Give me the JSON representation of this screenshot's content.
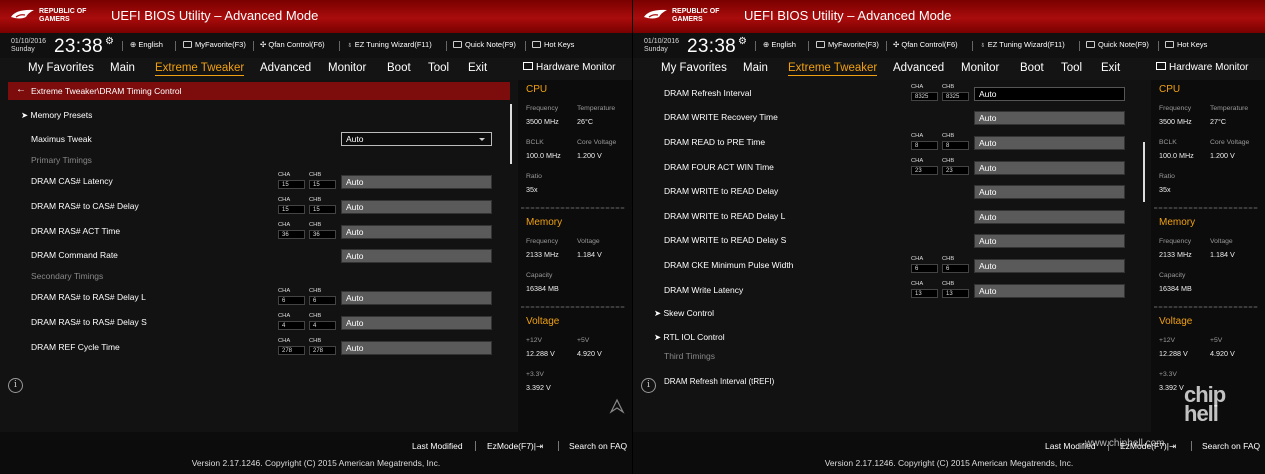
{
  "header": {
    "brand": "REPUBLIC OF\nGAMERS",
    "title": "UEFI BIOS Utility – Advanced Mode"
  },
  "infobar": {
    "date": "01/10/2016",
    "day": "Sunday",
    "time": "23:38",
    "tools": [
      "English",
      "MyFavorite(F3)",
      "Qfan Control(F6)",
      "EZ Tuning Wizard(F11)",
      "Quick Note(F9)",
      "Hot Keys"
    ]
  },
  "menu": {
    "items": [
      "My Favorites",
      "Main",
      "Extreme Tweaker",
      "Advanced",
      "Monitor",
      "Boot",
      "Tool",
      "Exit"
    ],
    "active": "Extreme Tweaker",
    "hardware_monitor": "Hardware Monitor"
  },
  "left_panel": {
    "breadcrumb": "Extreme Tweaker\\DRAM Timing Control",
    "memory_presets": "Memory Presets",
    "maximus_tweak": {
      "label": "Maximus Tweak",
      "value": "Auto"
    },
    "primary_timings": "Primary Timings",
    "secondary_timings": "Secondary Timings",
    "rows": [
      {
        "label": "DRAM CAS# Latency",
        "cha": "15",
        "chb": "15",
        "value": "Auto"
      },
      {
        "label": "DRAM RAS# to CAS# Delay",
        "cha": "15",
        "chb": "15",
        "value": "Auto"
      },
      {
        "label": "DRAM RAS# ACT Time",
        "cha": "36",
        "chb": "36",
        "value": "Auto"
      },
      {
        "label": "DRAM Command Rate",
        "cha": "",
        "chb": "",
        "value": "Auto"
      },
      {
        "label": "DRAM RAS# to RAS# Delay L",
        "cha": "6",
        "chb": "6",
        "value": "Auto"
      },
      {
        "label": "DRAM RAS# to RAS# Delay S",
        "cha": "4",
        "chb": "4",
        "value": "Auto"
      },
      {
        "label": "DRAM REF Cycle Time",
        "cha": "278",
        "chb": "278",
        "value": "Auto"
      }
    ]
  },
  "right_panel": {
    "rows": [
      {
        "label": "DRAM Refresh Interval",
        "cha": "8325",
        "chb": "8325",
        "value": "Auto"
      },
      {
        "label": "DRAM WRITE Recovery Time",
        "cha": "",
        "chb": "",
        "value": "Auto"
      },
      {
        "label": "DRAM READ to PRE Time",
        "cha": "8",
        "chb": "8",
        "value": "Auto"
      },
      {
        "label": "DRAM FOUR ACT WIN Time",
        "cha": "23",
        "chb": "23",
        "value": "Auto"
      },
      {
        "label": "DRAM WRITE to READ Delay",
        "cha": "",
        "chb": "",
        "value": "Auto"
      },
      {
        "label": "DRAM WRITE to READ Delay L",
        "cha": "",
        "chb": "",
        "value": "Auto"
      },
      {
        "label": "DRAM WRITE to READ Delay S",
        "cha": "",
        "chb": "",
        "value": "Auto"
      },
      {
        "label": "DRAM CKE Minimum Pulse Width",
        "cha": "6",
        "chb": "6",
        "value": "Auto"
      },
      {
        "label": "DRAM Write Latency",
        "cha": "13",
        "chb": "13",
        "value": "Auto"
      }
    ],
    "skew_control": "Skew Control",
    "rtl_iol_control": "RTL IOL Control",
    "third_timings": "Third Timings",
    "refresh_interval_trefi": "DRAM Refresh Interval (tREFI)"
  },
  "channel_labels": {
    "cha": "CHA",
    "chb": "CHB"
  },
  "hw_left": {
    "cpu": {
      "title": "CPU",
      "frequency_label": "Frequency",
      "frequency": "3500 MHz",
      "temperature_label": "Temperature",
      "temperature": "26°C",
      "bclk_label": "BCLK",
      "bclk": "100.0 MHz",
      "core_voltage_label": "Core Voltage",
      "core_voltage": "1.200 V",
      "ratio_label": "Ratio",
      "ratio": "35x"
    },
    "memory": {
      "title": "Memory",
      "frequency_label": "Frequency",
      "frequency": "2133 MHz",
      "voltage_label": "Voltage",
      "voltage": "1.184 V",
      "capacity_label": "Capacity",
      "capacity": "16384 MB"
    },
    "voltage": {
      "title": "Voltage",
      "v12_label": "+12V",
      "v12": "12.288 V",
      "v5_label": "+5V",
      "v5": "4.920 V",
      "v33_label": "+3.3V",
      "v33": "3.392 V"
    }
  },
  "hw_right": {
    "cpu": {
      "title": "CPU",
      "frequency_label": "Frequency",
      "frequency": "3500 MHz",
      "temperature_label": "Temperature",
      "temperature": "27°C",
      "bclk_label": "BCLK",
      "bclk": "100.0 MHz",
      "core_voltage_label": "Core Voltage",
      "core_voltage": "1.200 V",
      "ratio_label": "Ratio",
      "ratio": "35x"
    },
    "memory": {
      "title": "Memory",
      "frequency_label": "Frequency",
      "frequency": "2133 MHz",
      "voltage_label": "Voltage",
      "voltage": "1.184 V",
      "capacity_label": "Capacity",
      "capacity": "16384 MB"
    },
    "voltage": {
      "title": "Voltage",
      "v12_label": "+12V",
      "v12": "12.288 V",
      "v5_label": "+5V",
      "v5": "4.920 V",
      "v33_label": "+3.3V",
      "v33": "3.392 V"
    }
  },
  "footer": {
    "last_modified": "Last Modified",
    "ezmode": "EzMode(F7)|⇥",
    "search": "Search on FAQ",
    "version": "Version 2.17.1246. Copyright (C) 2015 American Megatrends, Inc."
  },
  "watermark": {
    "logo": "chip\nhell",
    "url": "www.chiphell.com"
  },
  "colors": {
    "accent": "#f0a010",
    "brand_red": "#aa0c0c",
    "crumb_red": "#7d0d0d"
  }
}
